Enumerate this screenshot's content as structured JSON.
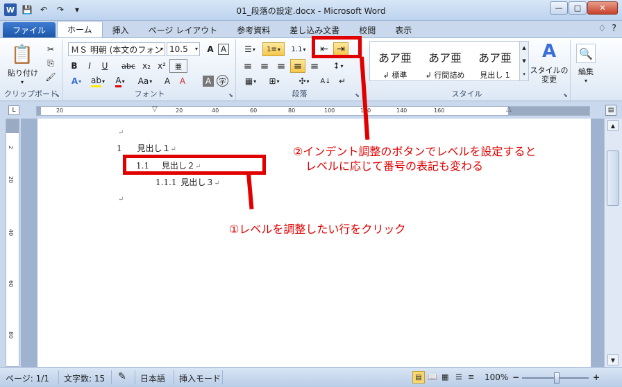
{
  "window": {
    "title": "01_段落の設定.docx - Microsoft Word",
    "buttons": {
      "minimize": "—",
      "maximize": "□",
      "close": "✕"
    }
  },
  "qat": {
    "app_icon": "W",
    "save": "💾",
    "undo": "↶",
    "redo": "↷",
    "customize": "▾"
  },
  "tabs": [
    {
      "label": "ファイル"
    },
    {
      "label": "ホーム"
    },
    {
      "label": "挿入"
    },
    {
      "label": "ページ レイアウト"
    },
    {
      "label": "参考資料"
    },
    {
      "label": "差し込み文書"
    },
    {
      "label": "校閲"
    },
    {
      "label": "表示"
    }
  ],
  "tabs_right": {
    "minimize_ribbon": "♢",
    "help": "?"
  },
  "ribbon": {
    "clipboard": {
      "label": "クリップボード",
      "paste": "貼り付け",
      "paste_dd": "▾"
    },
    "font": {
      "label": "フォント",
      "font_name": "ＭＳ 明朝 (本文のフォン",
      "font_size": "10.5",
      "bold": "B",
      "italic": "I",
      "underline": "U",
      "strike": "abc",
      "subscript": "x₂",
      "superscript": "x²",
      "grow": "A",
      "shrink": "A",
      "case": "Aa",
      "clear": "A",
      "effects": "A",
      "highlight": "ab",
      "color": "A",
      "char_border": "A",
      "enclosed": "字",
      "phonetic": "亜"
    },
    "paragraph": {
      "label": "段落",
      "bullets": "☰",
      "numbering": "1≡",
      "multilevel": "1.1",
      "decrease_indent": "⇤",
      "increase_indent": "⇥",
      "align_left": "≡",
      "align_center": "≡",
      "align_right": "≡",
      "justify": "≡",
      "distributed": "≡",
      "line_spacing": "↕",
      "shading": "▦",
      "borders": "⊞",
      "show_marks": "↵",
      "sort": "A↓"
    },
    "styles": {
      "label": "スタイル",
      "items": [
        {
          "preview": "あア亜",
          "name": "標準"
        },
        {
          "preview": "あア亜",
          "name": "行間詰め"
        },
        {
          "preview": "あア亜",
          "name": "見出し 1"
        }
      ],
      "change_styles": "スタイルの変更",
      "change_icon": "A"
    },
    "editing": {
      "label": "編集",
      "icon": "🔍"
    }
  },
  "ruler": {
    "ticks": [
      "20",
      "20",
      "40",
      "60",
      "80",
      "100",
      "120",
      "140",
      "160"
    ],
    "vticks": [
      "2",
      "20",
      "40",
      "60",
      "80"
    ]
  },
  "document": {
    "lines": [
      {
        "text": "↵"
      },
      {
        "num": "1",
        "text": "見出し１",
        "mark": "↵"
      },
      {
        "num": "1.1",
        "text": "見出し２",
        "mark": "↵"
      },
      {
        "num": "1.1.1",
        "text": "見出し３",
        "mark": "↵"
      },
      {
        "text": "↵"
      }
    ]
  },
  "annotations": {
    "step1": "①レベルを調整したい行をクリック",
    "step2_line1": "②インデント調整のボタンでレベルを設定すると",
    "step2_line2": "レベルに応じて番号の表記も変わる"
  },
  "statusbar": {
    "page": "ページ: 1/1",
    "words": "文字数: 15",
    "proofing": "✎",
    "language": "日本語",
    "mode": "挿入モード",
    "zoom": "100%",
    "zoom_out": "−",
    "zoom_in": "+"
  },
  "colors": {
    "annotation_red": "#e00000",
    "ribbon_blue": "#1d56a8"
  }
}
